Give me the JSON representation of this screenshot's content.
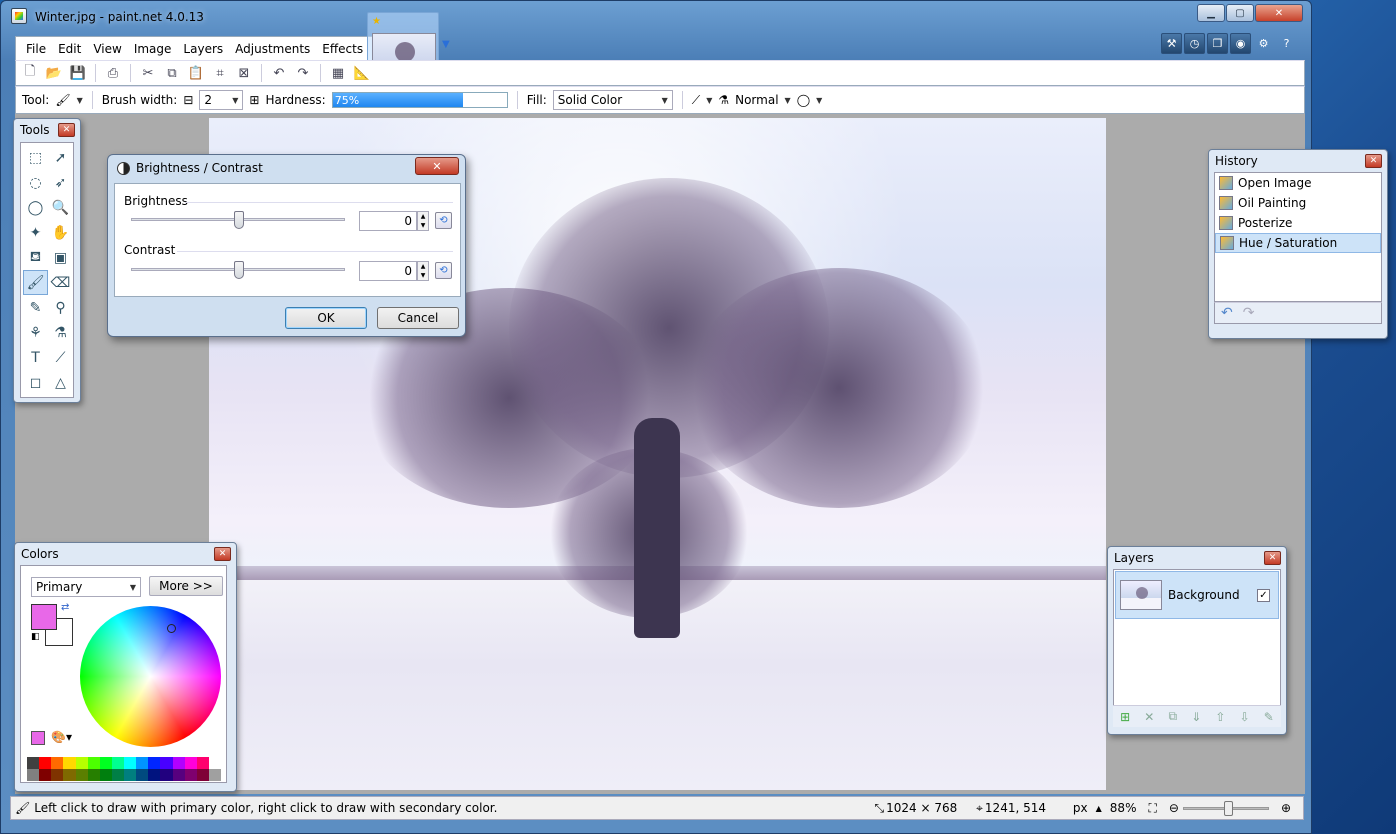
{
  "window": {
    "title": "Winter.jpg - paint.net 4.0.13"
  },
  "menu": [
    "File",
    "Edit",
    "View",
    "Image",
    "Layers",
    "Adjustments",
    "Effects"
  ],
  "options": {
    "tool_label": "Tool:",
    "brush_width_label": "Brush width:",
    "brush_width_value": "2",
    "hardness_label": "Hardness:",
    "hardness_value": "75%",
    "hardness_fraction": 0.75,
    "fill_label": "Fill:",
    "fill_value": "Solid Color",
    "blend_value": "Normal"
  },
  "tools_panel": {
    "title": "Tools"
  },
  "history_panel": {
    "title": "History",
    "items": [
      "Open Image",
      "Oil Painting",
      "Posterize",
      "Hue / Saturation"
    ]
  },
  "dialog": {
    "title": "Brightness / Contrast",
    "brightness_label": "Brightness",
    "contrast_label": "Contrast",
    "brightness_value": "0",
    "contrast_value": "0",
    "ok_label": "OK",
    "cancel_label": "Cancel"
  },
  "colors_panel": {
    "title": "Colors",
    "mode": "Primary",
    "more_label": "More >>",
    "primary_color": "#e868e8"
  },
  "layers_panel": {
    "title": "Layers",
    "layers": [
      {
        "name": "Background",
        "visible": "✓"
      }
    ]
  },
  "status": {
    "hint": "Left click to draw with primary color, right click to draw with secondary color.",
    "image_size": "1024 × 768",
    "cursor": "1241, 514",
    "units": "px",
    "zoom": "88%"
  }
}
